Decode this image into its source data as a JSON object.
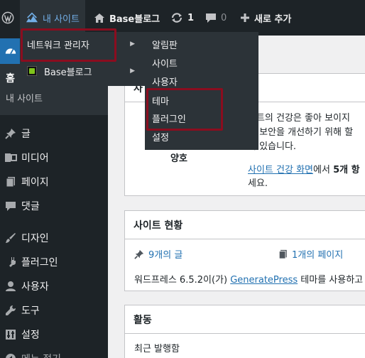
{
  "adminbar": {
    "my_sites": "내 사이트",
    "site_name": "Base블로그",
    "updates_count": "1",
    "comments_count": "0",
    "new_label": "새로 추가"
  },
  "menu": {
    "home": "홈",
    "my_sites": "내 사이트",
    "items": [
      {
        "label": "글",
        "icon": "pin-icon"
      },
      {
        "label": "미디어",
        "icon": "media-icon"
      },
      {
        "label": "페이지",
        "icon": "page-icon"
      },
      {
        "label": "댓글",
        "icon": "comment-icon"
      },
      {
        "label": "디자인",
        "icon": "brush-icon"
      },
      {
        "label": "플러그인",
        "icon": "plugin-icon"
      },
      {
        "label": "사용자",
        "icon": "user-icon"
      },
      {
        "label": "도구",
        "icon": "wrench-icon"
      },
      {
        "label": "설정",
        "icon": "settings-icon"
      },
      {
        "label": "메뉴 접기",
        "icon": "collapse-icon"
      }
    ]
  },
  "dropdown": {
    "network_admin": "네트워크 관리자",
    "base_blog": "Base블로그",
    "network_submenu": [
      "알림판",
      "사이트",
      "사용자",
      "테마",
      "플러그인",
      "설정"
    ]
  },
  "health": {
    "title_partial": "사",
    "status": "양호",
    "line1": "이트의 건강은 좋아 보이지",
    "line2": "과 보안을 개선하기 위해 할",
    "line3": "이 있습니다.",
    "link": "사이트 건강 화면",
    "suffix_pre": "에서 ",
    "suffix_bold": "5개 항",
    "line5": "세요."
  },
  "glance": {
    "title": "사이트 현황",
    "posts": "9개의 글",
    "pages": "1개의 페이지",
    "wp_pre": "워드프레스 6.5.2이(가) ",
    "theme_link": "GeneratePress",
    "wp_post": " 테마를 사용하고 있"
  },
  "activity": {
    "title": "활동",
    "recent": "최근 발행함"
  }
}
